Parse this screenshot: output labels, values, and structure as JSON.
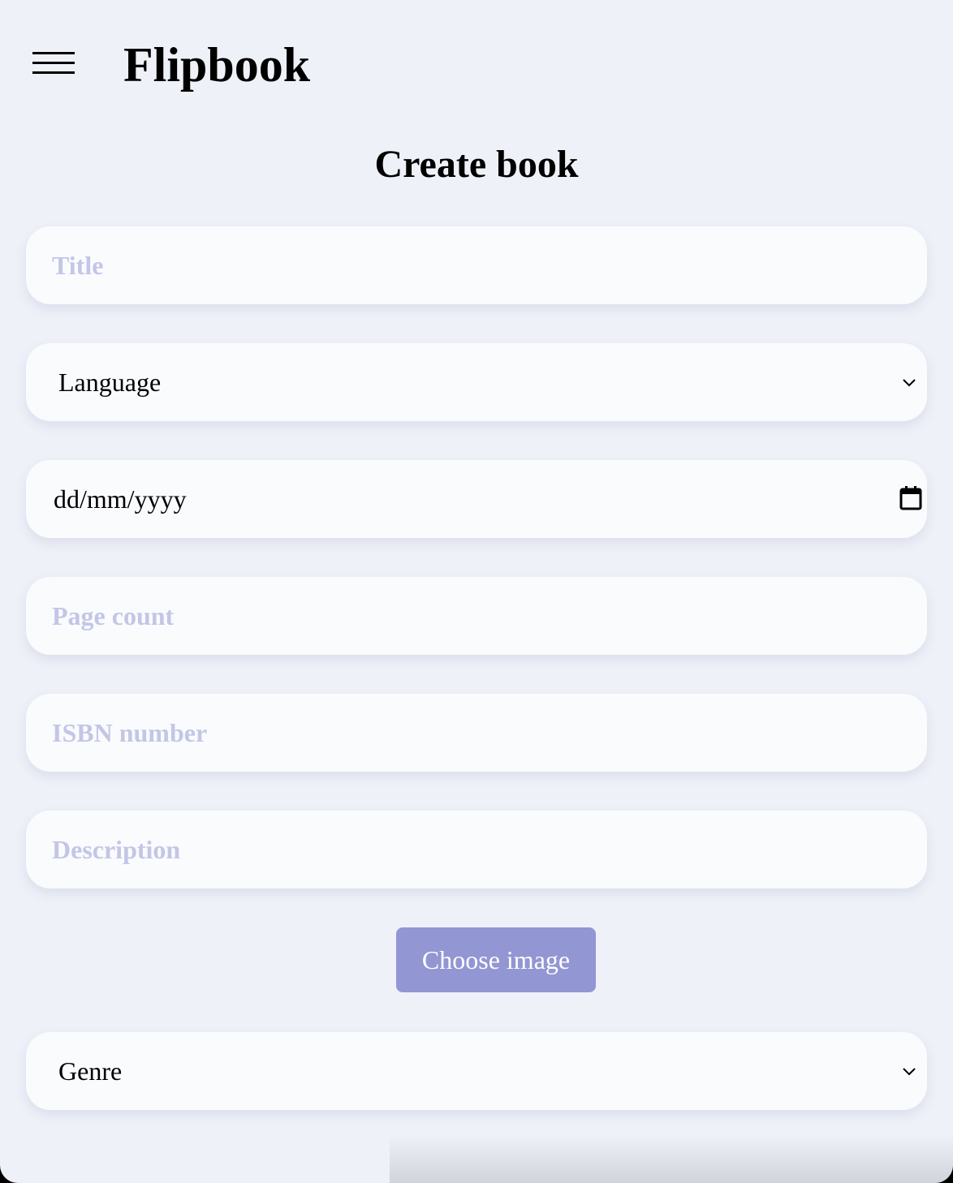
{
  "header": {
    "brand": "Flipbook",
    "menu_icon": "hamburger-menu-icon"
  },
  "page": {
    "title": "Create book"
  },
  "form": {
    "title_placeholder": "Title",
    "language_selected": "Language",
    "date_placeholder": "dd/mm/yyyy",
    "page_count_placeholder": "Page count",
    "isbn_placeholder": "ISBN number",
    "description_placeholder": "Description",
    "choose_image_label": "Choose image",
    "genre_selected": "Genre"
  },
  "colors": {
    "background": "#eef1f8",
    "field_background": "#fafbfd",
    "placeholder": "#c3c6e6",
    "accent_button": "#9296d3"
  }
}
